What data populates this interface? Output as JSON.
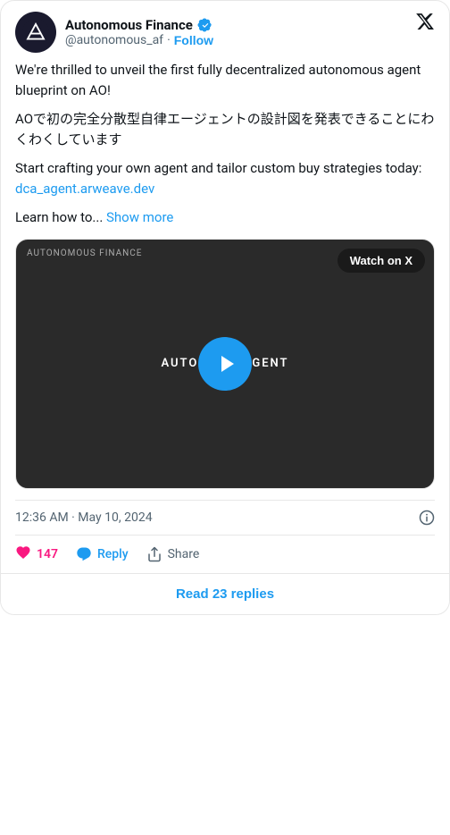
{
  "header": {
    "account_name": "Autonomous Finance",
    "account_handle": "@autonomous_af",
    "dot": "·",
    "follow_label": "Follow",
    "x_logo_alt": "X logo"
  },
  "tweet": {
    "body_en": "We're thrilled to unveil the first fully decentralized autonomous agent blueprint on AO!",
    "body_ja": "AOで初の完全分散型自律エージェントの設計図を発表できることにわくわくしています",
    "body_cta": "Start crafting your own agent and tailor custom buy strategies today:",
    "link_text": "dca_agent.arweave.dev",
    "learn_prefix": "Learn how to...",
    "show_more": "Show more"
  },
  "video": {
    "watermark": "AUTONOMOUS FINANCE",
    "watch_label": "Watch on X",
    "text_left": "AUTO",
    "text_right": "GENT"
  },
  "timestamp": {
    "time": "12:36 AM · May 10, 2024"
  },
  "stats": {
    "likes": "147",
    "reply_label": "Reply",
    "share_label": "Share"
  },
  "footer": {
    "read_replies": "Read 23 replies"
  }
}
